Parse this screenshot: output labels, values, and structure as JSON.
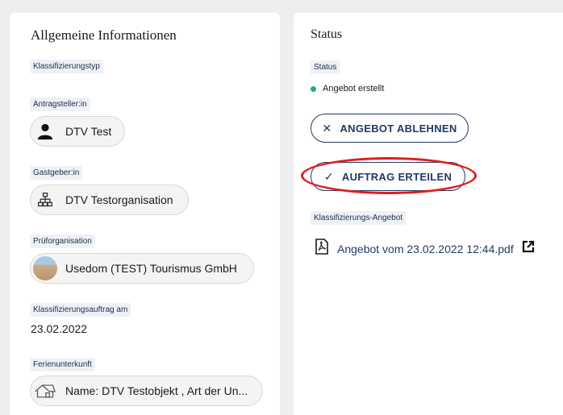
{
  "left_card": {
    "title": "Allgemeine Informationen",
    "fields": {
      "klassifizierungstyp": {
        "label": "Klassifizierungstyp"
      },
      "antragsteller": {
        "label": "Antragsteller:in",
        "value": "DTV Test",
        "icon": "person-icon"
      },
      "gastgeber": {
        "label": "Gastgeber:in",
        "value": "DTV Testorganisation",
        "icon": "organization-icon"
      },
      "pruefstelle": {
        "label": "Prüforganisation",
        "value": "Usedom (TEST) Tourismus GmbH",
        "icon": "beach-photo-avatar"
      },
      "auftrag": {
        "label": "Klassifizierungsauftrag am",
        "value": "23.02.2022"
      },
      "ferienunterkunft": {
        "label": "Ferienunterkunft",
        "value": "Name: DTV Testobjekt , Art der Un...",
        "icon": "house-icon"
      }
    }
  },
  "right_card": {
    "title": "Status",
    "status": {
      "label": "Status",
      "value": "Angebot erstellt",
      "dot_color": "#1fa88f"
    },
    "buttons": {
      "ablehnen": {
        "label": "ANGEBOT ABLEHNEN",
        "icon": "close-icon"
      },
      "erteilen": {
        "label": "AUFTRAG ERTEILEN",
        "icon": "check-icon"
      }
    },
    "angebot": {
      "label": "Klassifizierungs-Angebot",
      "file": "Angebot vom 23.02.2022 12:44.pdf"
    }
  },
  "colors": {
    "accent": "#1f3a66",
    "highlight": "#e01e1e",
    "label_bg": "#eef2f7"
  }
}
